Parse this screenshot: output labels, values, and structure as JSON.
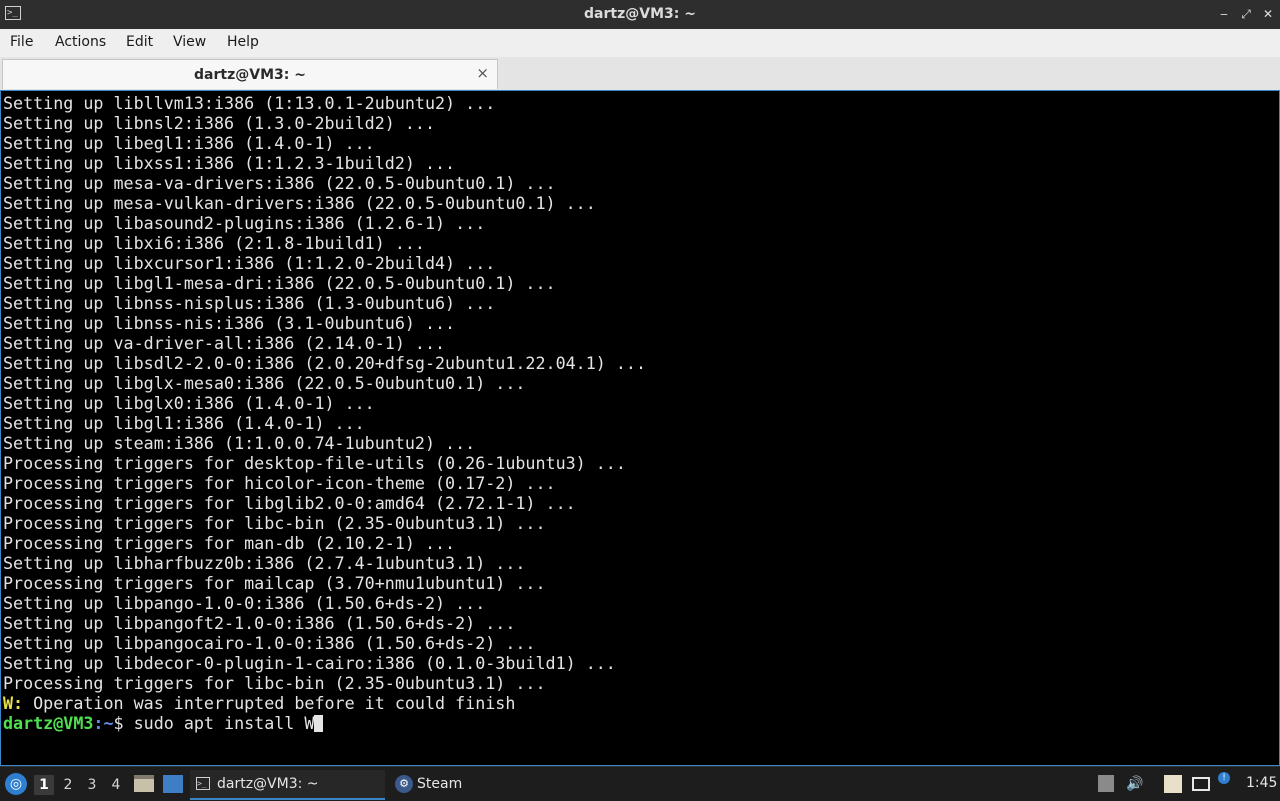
{
  "window": {
    "title": "dartz@VM3: ~",
    "app_icon": "terminal-icon",
    "controls": [
      "minimize-icon",
      "restore-icon",
      "close-icon"
    ]
  },
  "menu": {
    "items": [
      "File",
      "Actions",
      "Edit",
      "View",
      "Help"
    ]
  },
  "tab": {
    "label": "dartz@VM3: ~",
    "close_glyph": "×"
  },
  "terminal": {
    "lines": [
      "Setting up libllvm13:i386 (1:13.0.1-2ubuntu2) ...",
      "Setting up libnsl2:i386 (1.3.0-2build2) ...",
      "Setting up libegl1:i386 (1.4.0-1) ...",
      "Setting up libxss1:i386 (1:1.2.3-1build2) ...",
      "Setting up mesa-va-drivers:i386 (22.0.5-0ubuntu0.1) ...",
      "Setting up mesa-vulkan-drivers:i386 (22.0.5-0ubuntu0.1) ...",
      "Setting up libasound2-plugins:i386 (1.2.6-1) ...",
      "Setting up libxi6:i386 (2:1.8-1build1) ...",
      "Setting up libxcursor1:i386 (1:1.2.0-2build4) ...",
      "Setting up libgl1-mesa-dri:i386 (22.0.5-0ubuntu0.1) ...",
      "Setting up libnss-nisplus:i386 (1.3-0ubuntu6) ...",
      "Setting up libnss-nis:i386 (3.1-0ubuntu6) ...",
      "Setting up va-driver-all:i386 (2.14.0-1) ...",
      "Setting up libsdl2-2.0-0:i386 (2.0.20+dfsg-2ubuntu1.22.04.1) ...",
      "Setting up libglx-mesa0:i386 (22.0.5-0ubuntu0.1) ...",
      "Setting up libglx0:i386 (1.4.0-1) ...",
      "Setting up libgl1:i386 (1.4.0-1) ...",
      "Setting up steam:i386 (1:1.0.0.74-1ubuntu2) ...",
      "Processing triggers for desktop-file-utils (0.26-1ubuntu3) ...",
      "Processing triggers for hicolor-icon-theme (0.17-2) ...",
      "Processing triggers for libglib2.0-0:amd64 (2.72.1-1) ...",
      "Processing triggers for libc-bin (2.35-0ubuntu3.1) ...",
      "Processing triggers for man-db (2.10.2-1) ...",
      "Setting up libharfbuzz0b:i386 (2.7.4-1ubuntu3.1) ...",
      "Processing triggers for mailcap (3.70+nmu1ubuntu1) ...",
      "Setting up libpango-1.0-0:i386 (1.50.6+ds-2) ...",
      "Setting up libpangoft2-1.0-0:i386 (1.50.6+ds-2) ...",
      "Setting up libpangocairo-1.0-0:i386 (1.50.6+ds-2) ...",
      "Setting up libdecor-0-plugin-1-cairo:i386 (0.1.0-3build1) ...",
      "Processing triggers for libc-bin (2.35-0ubuntu3.1) ..."
    ],
    "warning": {
      "prefix": "W:",
      "text": " Operation was interrupted before it could finish"
    },
    "prompt": {
      "user_host": "dartz@VM3",
      "path": ":~",
      "symbol": "$",
      "command": " sudo apt install W"
    },
    "colors": {
      "background": "#000000",
      "text": "#e4e4e4",
      "prompt_user": "#4fe04f",
      "prompt_path": "#5f8fe8",
      "warning": "#e8e34a"
    }
  },
  "taskbar": {
    "start_icon": "lxqt-start-icon",
    "workspaces": [
      "1",
      "2",
      "3",
      "4"
    ],
    "active_workspace": "1",
    "launchers": [
      "file-manager-icon",
      "show-desktop-icon"
    ],
    "tasks": [
      {
        "label": "dartz@VM3: ~",
        "icon": "terminal-icon",
        "active": true
      },
      {
        "label": "Steam",
        "icon": "steam-icon",
        "active": false
      }
    ],
    "tray_icons": [
      "clipboard-icon",
      "volume-icon",
      "notes-icon",
      "display-icon",
      "update-notifier-icon"
    ],
    "clock": "1:45"
  }
}
